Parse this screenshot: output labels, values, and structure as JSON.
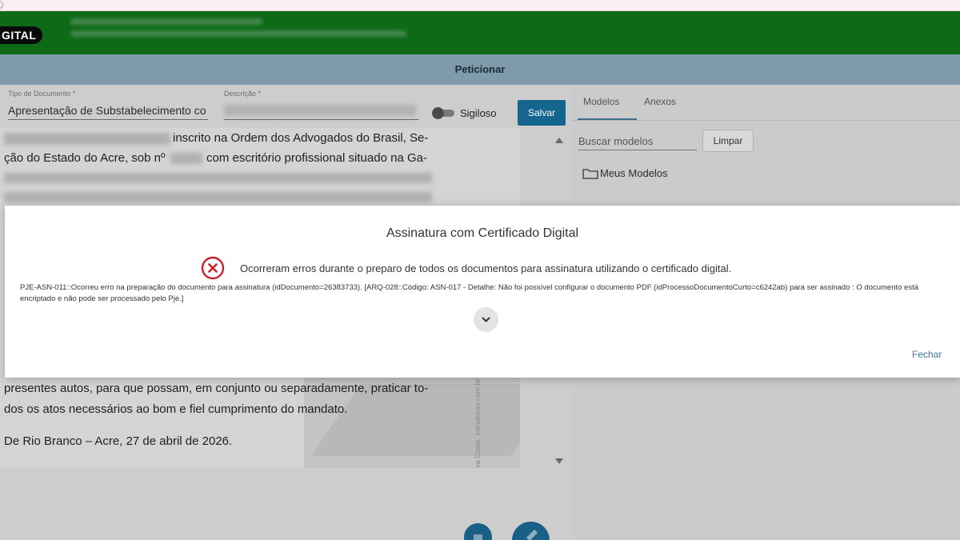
{
  "header": {
    "brand": "GITAL"
  },
  "title_bar": {
    "title": "Peticionar"
  },
  "form": {
    "tipo_label": "Tipo de Documento *",
    "tipo_value": "Apresentação de Substabelecimento co",
    "descricao_label": "Descrição *",
    "sigiloso_label": "Sigiloso",
    "salvar_label": "Salvar"
  },
  "document": {
    "lines": [
      "inscrito na Ordem dos Advogados do Brasil, Se-",
      "ção do Estado do Acre, sob nº",
      "com escritório profissional situado na Ga-",
      "presentes autos, para que possam, em conjunto ou separadamente, praticar to-",
      "dos os atos necessários ao bom e fiel cumprimento do mandato.",
      "De Rio Branco – Acre, 27 de abril de 2026."
    ],
    "watermark_text": "va Costa, ssinaturas.com.br e utiliz"
  },
  "side_panel": {
    "tabs": [
      "Modelos",
      "Anexos"
    ],
    "active_tab": "Modelos",
    "search_placeholder": "Buscar modelos",
    "limpar_label": "Limpar",
    "folder_label": "Meus Modelos"
  },
  "modal": {
    "title": "Assinatura com Certificado Digital",
    "error_message": "Ocorreram erros durante o preparo de todos os documentos para assinatura utilizando o certificado digital.",
    "error_detail": "PJE-ASN-011::Ocorreu erro na preparação do documento para assinatura (idDocumento=26383733). [ARQ-028::Código: ASN-017 - Detalhe: Não foi possível configurar o documento PDF (idProcessoDocumentoCurto=c6242ab) para ser assinado : O documento está encriptado e não pode ser processado pelo Pje.]",
    "close_label": "Fechar"
  },
  "colors": {
    "header_green": "#0d6a17",
    "title_bar": "#7e9aab",
    "primary_button": "#14668f",
    "error_red": "#c8202a",
    "link_blue": "#3c7a9f"
  },
  "icons": [
    "error-circle-icon",
    "chevron-down-icon",
    "folder-icon",
    "trash-icon",
    "pen-icon",
    "scroll-up-icon",
    "scroll-down-icon"
  ]
}
